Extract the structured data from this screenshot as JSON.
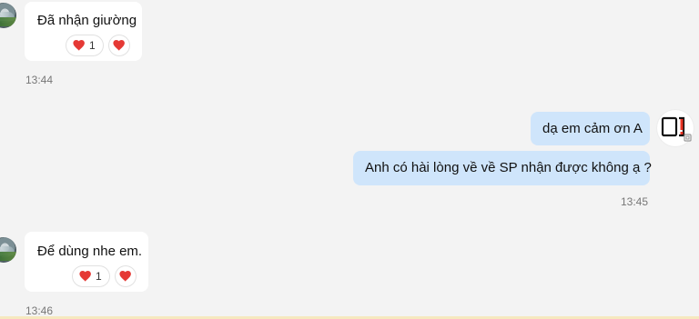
{
  "messages": [
    {
      "side": "left",
      "text": "Đã nhận giường",
      "reaction": "1",
      "time": "13:44"
    },
    {
      "side": "right",
      "text": "dạ em cảm ơn A"
    },
    {
      "side": "right",
      "text": "Anh có hài lòng về về SP nhận được không ạ ?",
      "time": "13:45"
    },
    {
      "side": "left",
      "text": "Để dùng nhe em.",
      "reaction": "1",
      "time": "13:46"
    }
  ],
  "icons": {
    "left_avatar": "contact-avatar",
    "right_avatar": "brand-avatar",
    "reaction": "heart-icon",
    "reaction_add": "heart-icon"
  },
  "colors": {
    "background": "#f3f3f3",
    "incoming_bubble": "#ffffff",
    "outgoing_bubble": "#cfe5fb",
    "heart": "#e53935",
    "timestamp": "#777777"
  }
}
